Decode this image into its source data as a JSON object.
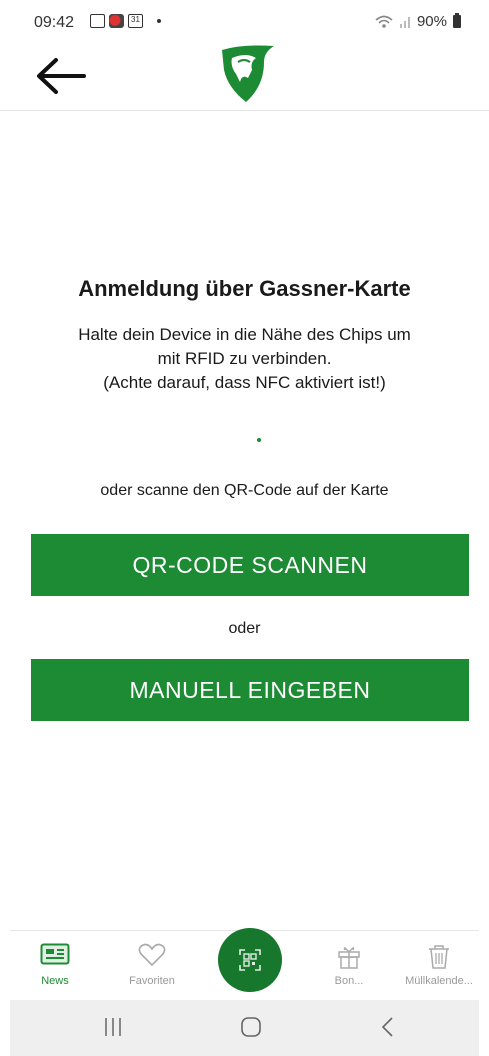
{
  "status_bar": {
    "time": "09:42",
    "battery": "90%",
    "calendar_day": "31"
  },
  "header": {
    "back_icon": "arrow-left-icon",
    "logo": "gassner-horse-logo"
  },
  "main": {
    "title": "Anmeldung über Gassner-Karte",
    "info_lines": [
      "Halte dein Device in die Nähe des Chips um",
      "mit RFID zu verbinden.",
      "(Achte darauf, dass NFC aktiviert ist!)"
    ],
    "scan_hint": "oder scanne den QR-Code auf der Karte",
    "qr_button_label": "QR-CODE SCANNEN",
    "or_label": "oder",
    "manual_button_label": "MANUELL EINGEBEN"
  },
  "bottom_nav": {
    "items": [
      {
        "label": "News",
        "icon": "news-icon",
        "active": true
      },
      {
        "label": "Favoriten",
        "icon": "heart-icon",
        "active": false
      },
      {
        "label": "Bon...",
        "icon": "gift-icon",
        "active": false
      },
      {
        "label": "Müllkalende...",
        "icon": "trash-icon",
        "active": false
      }
    ],
    "center_icon": "qr-scan-icon"
  },
  "colors": {
    "accent": "#1d8a34",
    "fab": "#17772c"
  }
}
